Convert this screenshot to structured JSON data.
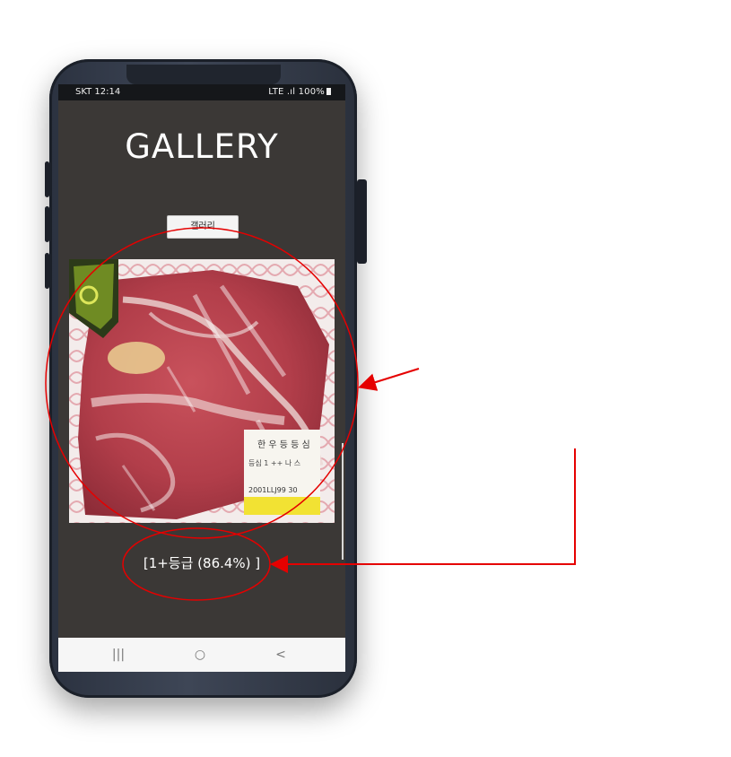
{
  "status_bar": {
    "carrier_time": "SKT 12:14",
    "indicators": "LTE .ıl 100%"
  },
  "app": {
    "title": "GALLERY",
    "gallery_button_label": "갤러리",
    "result_text": "[1+등급 (86.4%) ]"
  },
  "photo": {
    "subject": "packaged marbled beef cut with price label",
    "label_lines": [
      "한 우 등 등 심",
      "등심 1 ++ 나 스",
      "2001LLJ99 30"
    ]
  },
  "nav_bar": {
    "recents_glyph": "|||",
    "home_glyph": "○",
    "back_glyph": "<"
  },
  "annotations": {
    "highlight_color": "#e50000",
    "icons": [
      "recents-icon",
      "home-icon",
      "back-icon",
      "battery-icon",
      "signal-icon"
    ]
  }
}
